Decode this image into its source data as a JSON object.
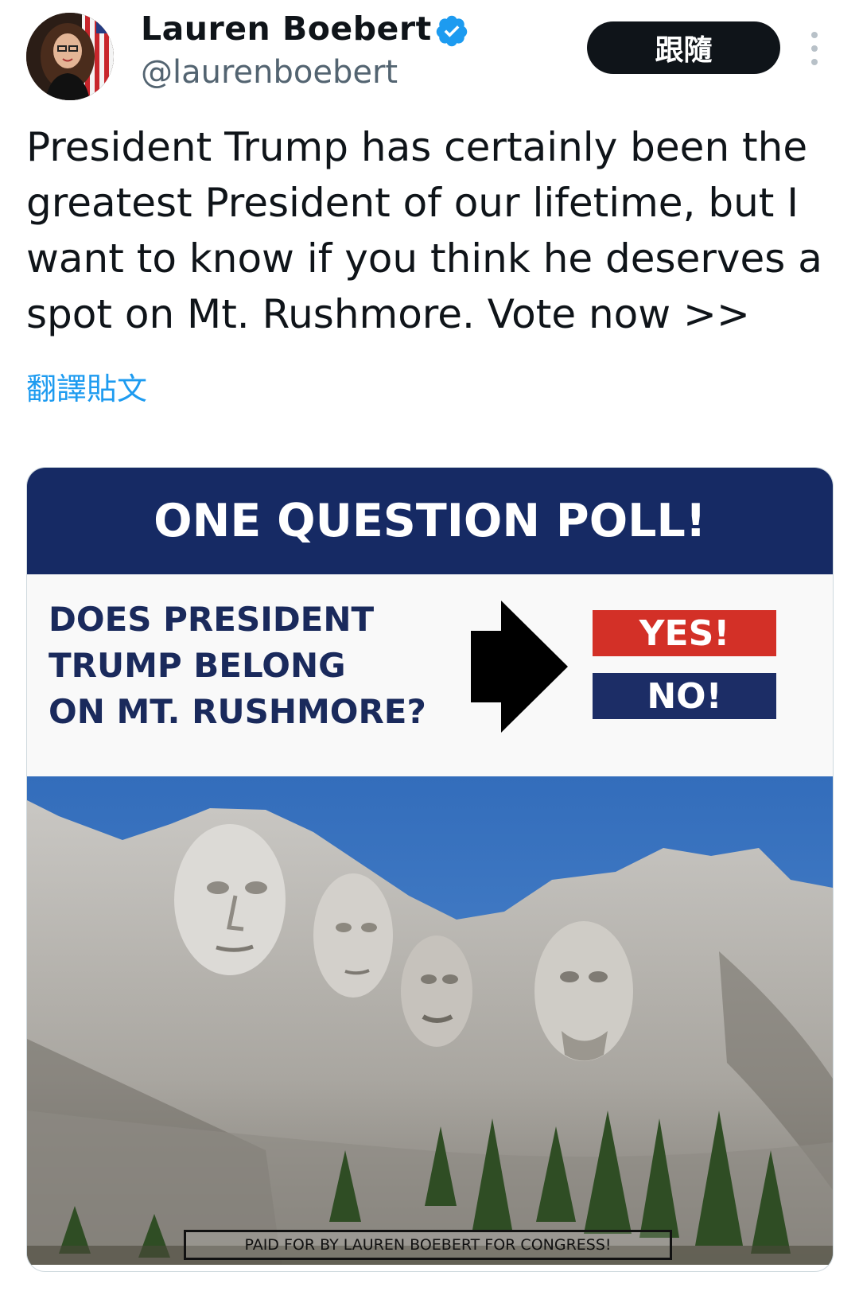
{
  "header": {
    "display_name": "Lauren Boebert",
    "handle": "@laurenboebert",
    "follow_label": "跟隨",
    "verified_color": "#1d9bf0"
  },
  "tweet": {
    "text": "President Trump has certainly been the greatest President of our lifetime, but I want to know if you think he deserves a spot on Mt. Rushmore. Vote now >>",
    "translate_label": "翻譯貼文"
  },
  "media": {
    "banner_title": "ONE QUESTION POLL!",
    "question": "DOES PRESIDENT\nTRUMP BELONG\nON MT. RUSHMORE?",
    "yes_label": "YES!",
    "no_label": "NO!",
    "disclaimer": "PAID FOR BY LAUREN BOEBERT FOR CONGRESS!",
    "colors": {
      "banner": "#162a64",
      "yes": "#d33027",
      "no": "#1c2d66",
      "sky": "#3f79c4"
    }
  },
  "icons": [
    "avatar",
    "verified-badge-icon",
    "more-options-icon",
    "arrow-right-icon"
  ]
}
